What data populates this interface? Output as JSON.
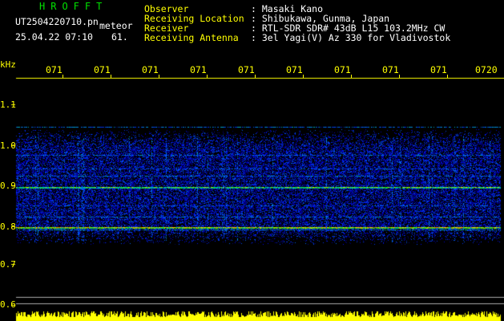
{
  "header": {
    "brand": "HROFFT",
    "filename": "UT2504220710.pn",
    "filetype": "meteor",
    "datetime": "25.04.22 07:10",
    "count": "61.",
    "fields": [
      {
        "label": "Observer",
        "value": ": Masaki Kano"
      },
      {
        "label": "Receiving Location",
        "value": ": Shibukawa, Gunma, Japan"
      },
      {
        "label": "Receiver",
        "value": ": RTL-SDR SDR# 43dB L15 103.2MHz CW"
      },
      {
        "label": "Receiving Antenna",
        "value": ": 3el Yagi(V) Az 330 for Vladivostok"
      }
    ]
  },
  "axes": {
    "y_unit": "kHz",
    "y_ticks": [
      "1.1",
      "1.0",
      "0.9",
      "0.8",
      "0.7",
      "0.6"
    ],
    "x_ticks": [
      "071",
      "071",
      "071",
      "071",
      "071",
      "071",
      "071",
      "071",
      "071",
      "0720"
    ]
  },
  "colors": {
    "background": "#000000",
    "text": "#ffffff",
    "axis": "#ffff00",
    "brand": "#00e000",
    "signal_low": "#000080",
    "signal_high": "#ff0000"
  }
}
